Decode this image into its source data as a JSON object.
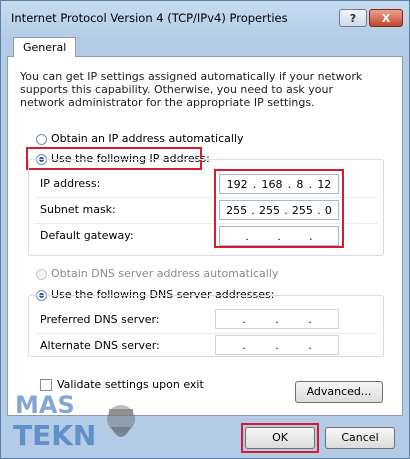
{
  "window": {
    "title": "Internet Protocol Version 4 (TCP/IPv4) Properties",
    "help_label": "?",
    "close_label": "X"
  },
  "tabs": [
    {
      "label": "General"
    }
  ],
  "intro_text": "You can get IP settings assigned automatically if your network supports this capability. Otherwise, you need to ask your network administrator for the appropriate IP settings.",
  "ip": {
    "auto_label": "Obtain an IP address automatically",
    "manual_label": "Use the following IP address:",
    "selected": "manual",
    "fields": [
      {
        "label": "IP address:",
        "octets": [
          "192",
          "168",
          "8",
          "12"
        ]
      },
      {
        "label": "Subnet mask:",
        "octets": [
          "255",
          "255",
          "255",
          "0"
        ]
      },
      {
        "label": "Default gateway:",
        "octets": [
          "",
          "",
          "",
          ""
        ]
      }
    ]
  },
  "dns": {
    "auto_label": "Obtain DNS server address automatically",
    "manual_label": "Use the following DNS server addresses:",
    "selected": "manual",
    "fields": [
      {
        "label": "Preferred DNS server:",
        "octets": [
          "",
          "",
          "",
          ""
        ]
      },
      {
        "label": "Alternate DNS server:",
        "octets": [
          "",
          "",
          "",
          ""
        ]
      }
    ]
  },
  "validate_label": "Validate settings upon exit",
  "validate_checked": false,
  "buttons": {
    "advanced": "Advanced...",
    "ok": "OK",
    "cancel": "Cancel"
  },
  "watermark": {
    "line1": "MAS",
    "line2": "TEKN"
  },
  "highlight_color": "#d21f2f"
}
